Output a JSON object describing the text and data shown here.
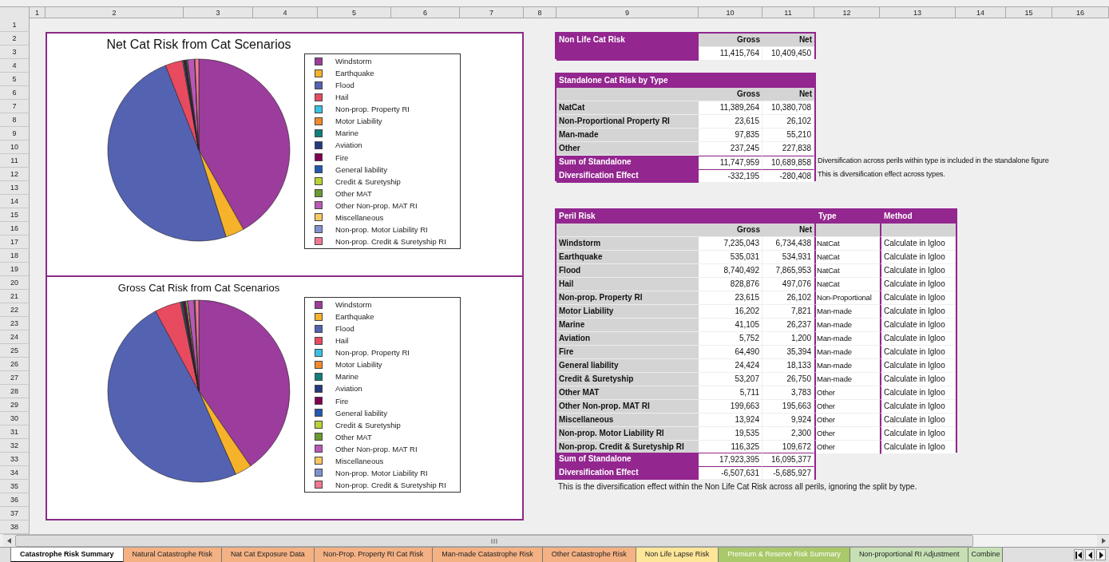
{
  "column_headers": [
    "1",
    "2",
    "3",
    "4",
    "5",
    "6",
    "7",
    "8",
    "9",
    "10",
    "11",
    "12",
    "13",
    "14",
    "15",
    "16"
  ],
  "row_headers": [
    "1",
    "2",
    "3",
    "4",
    "5",
    "6",
    "7",
    "8",
    "9",
    "10",
    "11",
    "12",
    "13",
    "14",
    "15",
    "16",
    "17",
    "18",
    "19",
    "20",
    "21",
    "22",
    "23",
    "24",
    "25",
    "26",
    "27",
    "28",
    "29",
    "30",
    "31",
    "32",
    "33",
    "34",
    "35",
    "36",
    "37",
    "38"
  ],
  "charts": [
    {
      "title": "Net Cat Risk from Cat Scenarios",
      "legend": [
        {
          "label": "Windstorm",
          "color": "#9c3c9c"
        },
        {
          "label": "Earthquake",
          "color": "#f5b22a"
        },
        {
          "label": "Flood",
          "color": "#5462b2"
        },
        {
          "label": "Hail",
          "color": "#e84a60"
        },
        {
          "label": "Non-prop. Property RI",
          "color": "#38c2e2"
        },
        {
          "label": "Motor Liability",
          "color": "#f28a2a"
        },
        {
          "label": "Marine",
          "color": "#0f7f78"
        },
        {
          "label": "Aviation",
          "color": "#263a80"
        },
        {
          "label": "Fire",
          "color": "#800052"
        },
        {
          "label": "General liability",
          "color": "#2458b2"
        },
        {
          "label": "Credit & Suretyship",
          "color": "#b6d434"
        },
        {
          "label": "Other MAT",
          "color": "#6a9a30"
        },
        {
          "label": "Other Non-prop. MAT RI",
          "color": "#b858b8"
        },
        {
          "label": "Miscellaneous",
          "color": "#f8c860"
        },
        {
          "label": "Non-prop. Motor Liability RI",
          "color": "#8090d0"
        },
        {
          "label": "Non-prop. Credit & Suretyship RI",
          "color": "#f07890"
        }
      ]
    },
    {
      "title": "Gross Cat Risk from Cat Scenarios",
      "legend": [
        {
          "label": "Windstorm",
          "color": "#9c3c9c"
        },
        {
          "label": "Earthquake",
          "color": "#f5b22a"
        },
        {
          "label": "Flood",
          "color": "#5462b2"
        },
        {
          "label": "Hail",
          "color": "#e84a60"
        },
        {
          "label": "Non-prop. Property RI",
          "color": "#38c2e2"
        },
        {
          "label": "Motor Liability",
          "color": "#f28a2a"
        },
        {
          "label": "Marine",
          "color": "#0f7f78"
        },
        {
          "label": "Aviation",
          "color": "#263a80"
        },
        {
          "label": "Fire",
          "color": "#800052"
        },
        {
          "label": "General liability",
          "color": "#2458b2"
        },
        {
          "label": "Credit & Suretyship",
          "color": "#b6d434"
        },
        {
          "label": "Other MAT",
          "color": "#6a9a30"
        },
        {
          "label": "Other Non-prop. MAT RI",
          "color": "#b858b8"
        },
        {
          "label": "Miscellaneous",
          "color": "#f8c860"
        },
        {
          "label": "Non-prop. Motor Liability RI",
          "color": "#8090d0"
        },
        {
          "label": "Non-prop. Credit & Suretyship RI",
          "color": "#f07890"
        }
      ]
    }
  ],
  "non_life_cat_risk": {
    "title": "Non Life Cat Risk",
    "columns": [
      "Gross",
      "Net"
    ],
    "values": [
      "11,415,764",
      "10,409,450"
    ]
  },
  "standalone_by_type": {
    "title": "Standalone Cat Risk by Type",
    "columns": [
      "Gross",
      "Net"
    ],
    "rows": [
      {
        "label": "NatCat",
        "gross": "11,389,264",
        "net": "10,380,708"
      },
      {
        "label": "Non-Proportional Property RI",
        "gross": "23,615",
        "net": "26,102"
      },
      {
        "label": "Man-made",
        "gross": "97,835",
        "net": "55,210"
      },
      {
        "label": "Other",
        "gross": "237,245",
        "net": "227,838"
      }
    ],
    "totals": [
      {
        "label": "Sum of Standalone",
        "gross": "11,747,959",
        "net": "10,689,858",
        "note": "Diversification across perils within type is included in the standalone figure"
      },
      {
        "label": "Diversification Effect",
        "gross": "-332,195",
        "net": "-280,408",
        "note": "This is diversification effect across types."
      }
    ]
  },
  "peril_risk": {
    "title": "Peril Risk",
    "columns": [
      "Gross",
      "Net"
    ],
    "type_heading": "Type",
    "method_heading": "Method",
    "rows": [
      {
        "label": "Windstorm",
        "gross": "7,235,043",
        "net": "6,734,438",
        "type": "NatCat",
        "method": "Calculate in Igloo"
      },
      {
        "label": "Earthquake",
        "gross": "535,031",
        "net": "534,931",
        "type": "NatCat",
        "method": "Calculate in Igloo"
      },
      {
        "label": "Flood",
        "gross": "8,740,492",
        "net": "7,865,953",
        "type": "NatCat",
        "method": "Calculate in Igloo"
      },
      {
        "label": "Hail",
        "gross": "828,876",
        "net": "497,076",
        "type": "NatCat",
        "method": "Calculate in Igloo"
      },
      {
        "label": "Non-prop. Property RI",
        "gross": "23,615",
        "net": "26,102",
        "type": "Non-Proportional",
        "method": "Calculate in Igloo"
      },
      {
        "label": "Motor Liability",
        "gross": "16,202",
        "net": "7,821",
        "type": "Man-made",
        "method": "Calculate in Igloo"
      },
      {
        "label": "Marine",
        "gross": "41,105",
        "net": "26,237",
        "type": "Man-made",
        "method": "Calculate in Igloo"
      },
      {
        "label": "Aviation",
        "gross": "5,752",
        "net": "1,200",
        "type": "Man-made",
        "method": "Calculate in Igloo"
      },
      {
        "label": "Fire",
        "gross": "64,490",
        "net": "35,394",
        "type": "Man-made",
        "method": "Calculate in Igloo"
      },
      {
        "label": "General liability",
        "gross": "24,424",
        "net": "18,133",
        "type": "Man-made",
        "method": "Calculate in Igloo"
      },
      {
        "label": "Credit & Suretyship",
        "gross": "53,207",
        "net": "26,750",
        "type": "Man-made",
        "method": "Calculate in Igloo"
      },
      {
        "label": "Other MAT",
        "gross": "5,711",
        "net": "3,783",
        "type": "Other",
        "method": "Calculate in Igloo"
      },
      {
        "label": "Other Non-prop. MAT RI",
        "gross": "199,663",
        "net": "195,663",
        "type": "Other",
        "method": "Calculate in Igloo"
      },
      {
        "label": "Miscellaneous",
        "gross": "13,924",
        "net": "9,924",
        "type": "Other",
        "method": "Calculate in Igloo"
      },
      {
        "label": "Non-prop. Motor Liability RI",
        "gross": "19,535",
        "net": "2,300",
        "type": "Other",
        "method": "Calculate in Igloo"
      },
      {
        "label": "Non-prop. Credit & Suretyship RI",
        "gross": "116,325",
        "net": "109,672",
        "type": "Other",
        "method": "Calculate in Igloo"
      }
    ],
    "totals": [
      {
        "label": "Sum of Standalone",
        "gross": "17,923,395",
        "net": "16,095,377"
      },
      {
        "label": "Diversification Effect",
        "gross": "-6,507,631",
        "net": "-5,685,927"
      }
    ],
    "note": "This is the diversification effect within the Non Life Cat Risk across all perils, ignoring the split by type."
  },
  "sheet_tabs": [
    {
      "label": "Catastrophe Risk Summary",
      "selected": true,
      "color": "#ffffff"
    },
    {
      "label": "Natural Catastrophe Risk",
      "selected": false,
      "color": "#f4b183"
    },
    {
      "label": "Nat Cat Exposure Data",
      "selected": false,
      "color": "#f4b183"
    },
    {
      "label": "Non-Prop. Property RI Cat Risk",
      "selected": false,
      "color": "#f4b183"
    },
    {
      "label": "Man-made Catastrophe Risk",
      "selected": false,
      "color": "#f4b183"
    },
    {
      "label": "Other Catastrophe Risk",
      "selected": false,
      "color": "#f4b183"
    },
    {
      "label": "Non Life Lapse Risk",
      "selected": false,
      "color": "#ffe699"
    },
    {
      "label": "Premium & Reserve Risk Summary",
      "selected": false,
      "color": "#a9c96a"
    },
    {
      "label": "Non-proportional RI Adjustment",
      "selected": false,
      "color": "#c6e0b4"
    },
    {
      "label": "Combine",
      "selected": false,
      "color": "#c6e0b4"
    }
  ]
}
